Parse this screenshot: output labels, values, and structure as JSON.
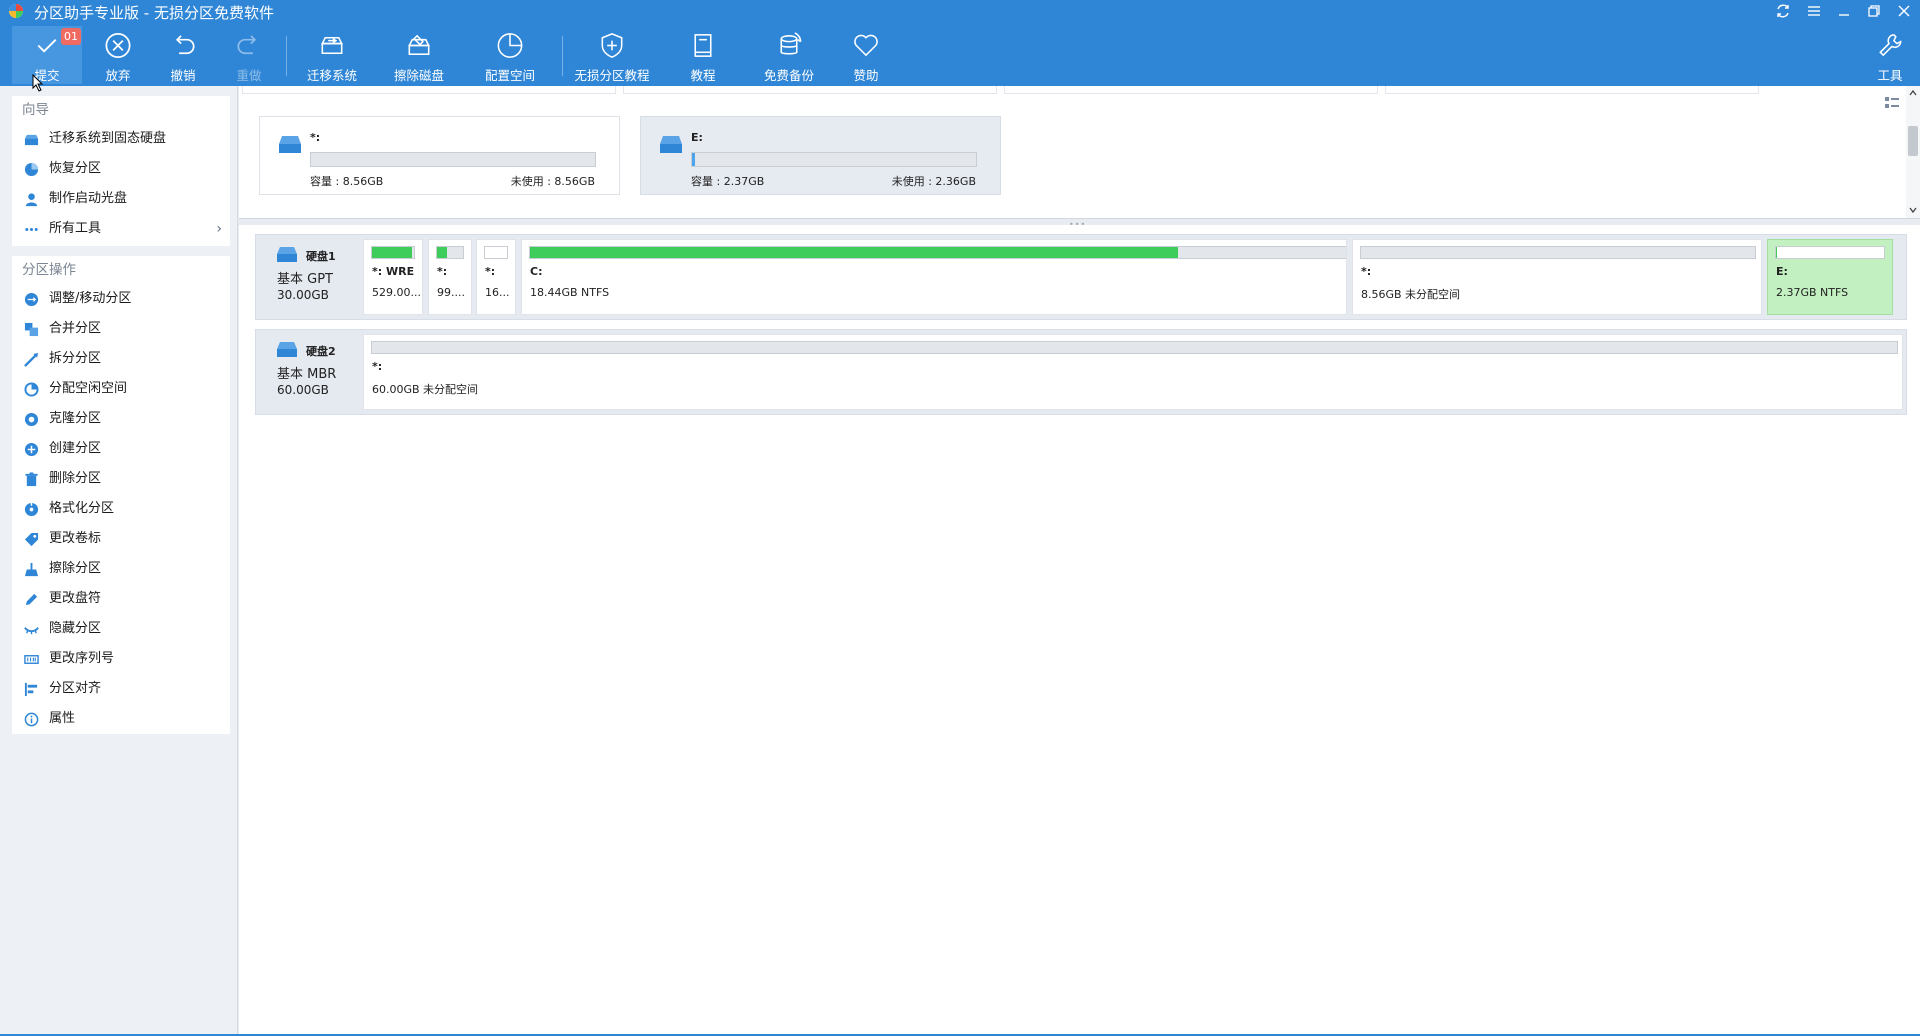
{
  "window": {
    "title": "分区助手专业版 - 无损分区免费软件"
  },
  "toolbar": {
    "commit_badge": "01",
    "buttons": [
      {
        "label": "提交",
        "icon": "check-icon"
      },
      {
        "label": "放弃",
        "icon": "discard-icon"
      },
      {
        "label": "撤销",
        "icon": "undo-icon"
      },
      {
        "label": "重做",
        "icon": "redo-icon"
      },
      {
        "label": "迁移系统",
        "icon": "migrate-system-icon"
      },
      {
        "label": "擦除磁盘",
        "icon": "wipe-disk-icon"
      },
      {
        "label": "配置空间",
        "icon": "allocate-space-icon"
      },
      {
        "label": "无损分区教程",
        "icon": "shield-icon"
      },
      {
        "label": "教程",
        "icon": "book-icon"
      },
      {
        "label": "免费备份",
        "icon": "backup-icon"
      },
      {
        "label": "赞助",
        "icon": "heart-icon"
      },
      {
        "label": "工具",
        "icon": "wrench-icon"
      }
    ]
  },
  "sidebar": {
    "wizard": {
      "title": "向导",
      "items": [
        "迁移系统到固态硬盘",
        "恢复分区",
        "制作启动光盘",
        "所有工具"
      ]
    },
    "operations": {
      "title": "分区操作",
      "items": [
        "调整/移动分区",
        "合并分区",
        "拆分分区",
        "分配空闲空间",
        "克隆分区",
        "创建分区",
        "删除分区",
        "格式化分区",
        "更改卷标",
        "擦除分区",
        "更改盘符",
        "隐藏分区",
        "更改序列号",
        "分区对齐",
        "属性"
      ]
    }
  },
  "partition_cards": [
    {
      "name": "*:",
      "capacity": "容量 : 8.56GB",
      "unused": "未使用 : 8.56GB",
      "used_fraction": 0.0,
      "selected": false
    },
    {
      "name": "E:",
      "capacity": "容量 : 2.37GB",
      "unused": "未使用 : 2.36GB",
      "used_fraction": 0.01,
      "selected": true
    }
  ],
  "disks": [
    {
      "name": "硬盘1",
      "type": "基本 GPT",
      "size": "30.00GB",
      "partitions": [
        {
          "name": "*: WRE",
          "desc": "529.00...",
          "used_fraction": 0.95,
          "selected": false
        },
        {
          "name": "*:",
          "desc": "99....",
          "used_fraction": 0.4,
          "selected": false
        },
        {
          "name": "*:",
          "desc": "16...",
          "used_fraction": 0.0,
          "selected": false
        },
        {
          "name": "C:",
          "desc": "18.44GB NTFS",
          "used_fraction": 0.79,
          "selected": false
        },
        {
          "name": "*:",
          "desc": "8.56GB 未分配空间",
          "used_fraction": 0.0,
          "selected": false
        },
        {
          "name": "E:",
          "desc": "2.37GB NTFS",
          "used_fraction": 0.01,
          "selected": true
        }
      ]
    },
    {
      "name": "硬盘2",
      "type": "基本 MBR",
      "size": "60.00GB",
      "partitions": [
        {
          "name": "*:",
          "desc": "60.00GB 未分配空间",
          "used_fraction": 0.0,
          "selected": false
        }
      ]
    }
  ],
  "colors": {
    "toolbar_bg": "#2f86d6",
    "used_space": "#3ecc5a",
    "selected_partition": "#c3f0c0"
  }
}
